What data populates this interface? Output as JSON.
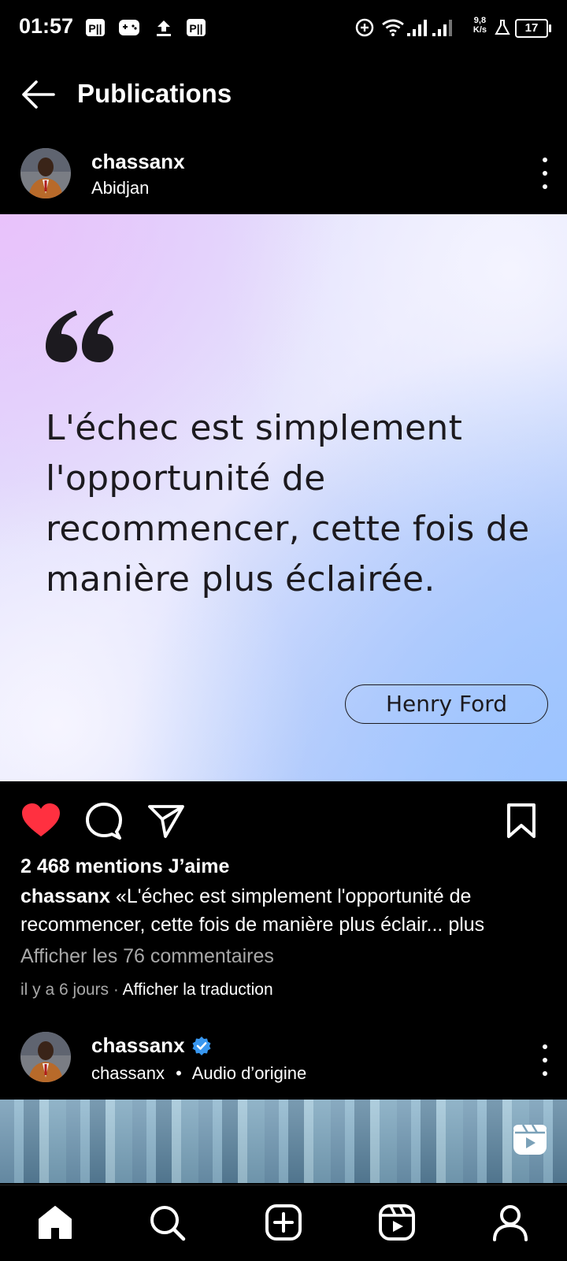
{
  "status_bar": {
    "time": "01:57",
    "net_speed_value": "9,8",
    "net_speed_unit": "K/s",
    "battery": "17"
  },
  "header": {
    "title": "Publications"
  },
  "post": {
    "username": "chassanx",
    "location": "Abidjan",
    "quote_text": "L'échec est simplement l'opportunité de recommencer, cette fois de manière plus éclairée.",
    "author": "Henry Ford",
    "liked": true,
    "likes_text": "2 468 mentions J’aime",
    "caption_user": "chassanx",
    "caption_text": "«L'échec est simplement l'opportunité de recommencer, cette fois de manière plus éclair...",
    "caption_more": "plus",
    "comments_link": "Afficher les 76 commentaires",
    "time_ago": "il y a 6 jours",
    "separator": "·",
    "translate_link": "Afficher la traduction"
  },
  "next_post": {
    "username": "chassanx",
    "verified": true,
    "audio_user": "chassanx",
    "dot": "•",
    "audio_label": "Audio d’origine"
  },
  "colors": {
    "like": "#ff3040",
    "verified": "#3897f0",
    "muted": "#a8a8a8"
  },
  "nav": [
    "home-icon",
    "search-icon",
    "create-icon",
    "reels-icon",
    "profile-icon"
  ]
}
